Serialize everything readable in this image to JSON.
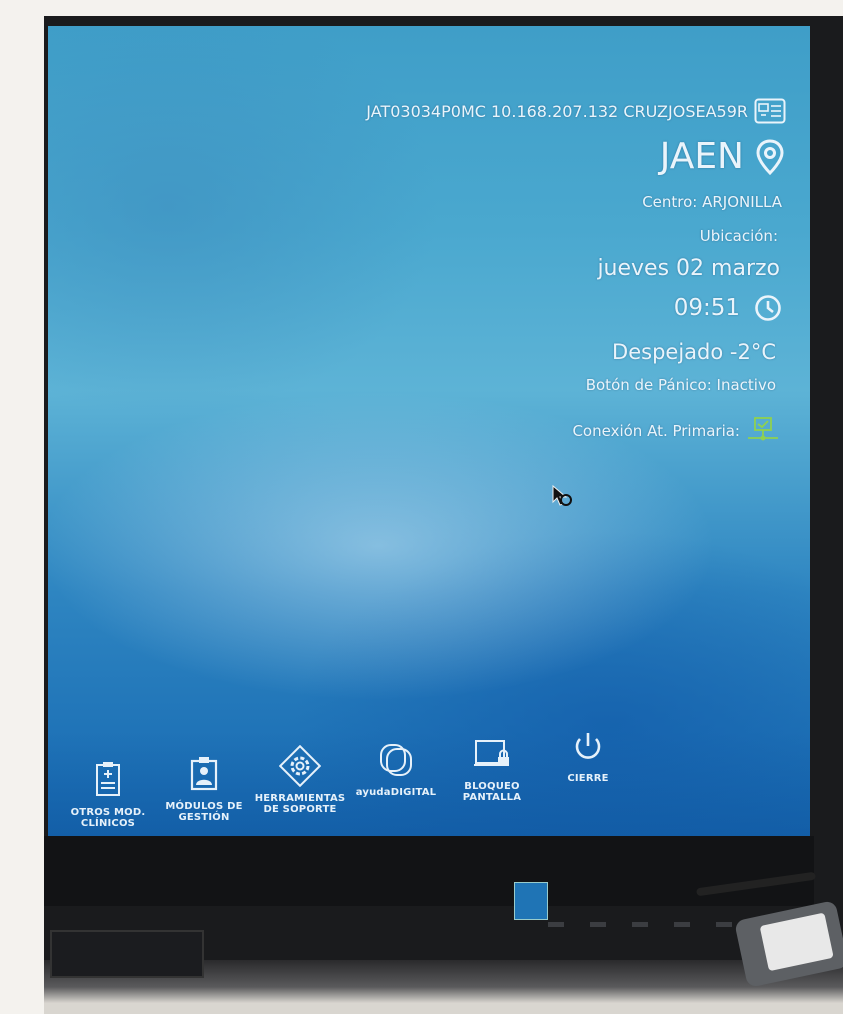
{
  "screen": {
    "machine_id": "JAT03034P0MC 10.168.207.132 CRUZJOSEA59R",
    "city": "JAEN",
    "centro": "Centro: ARJONILLA",
    "ubicacion": "Ubicación:",
    "date": "jueves 02 marzo",
    "time": "09:51",
    "weather": "Despejado -2°C",
    "panic_button": "Botón de Pánico: Inactivo",
    "connection": "Conexión At. Primaria:"
  },
  "taskbar": {
    "items": [
      {
        "label": "OTROS MOD. CLÍNICOS",
        "icon": "clipboard-icon"
      },
      {
        "label": "MÓDULOS DE GESTIÓN",
        "icon": "id-badge-icon"
      },
      {
        "label": "HERRAMIENTAS DE SOPORTE",
        "icon": "gear-icon"
      },
      {
        "label": "ayudaDIGITAL",
        "icon": "help-digital-icon"
      },
      {
        "label": "BLOQUEO PANTALLA",
        "icon": "lock-screen-icon"
      },
      {
        "label": "CIERRE",
        "icon": "power-icon"
      }
    ]
  },
  "colors": {
    "screen_top": "#3f9ec8",
    "screen_bottom": "#1567b1",
    "text": "#eaf4fb",
    "connection_ok": "#8fd14f"
  }
}
